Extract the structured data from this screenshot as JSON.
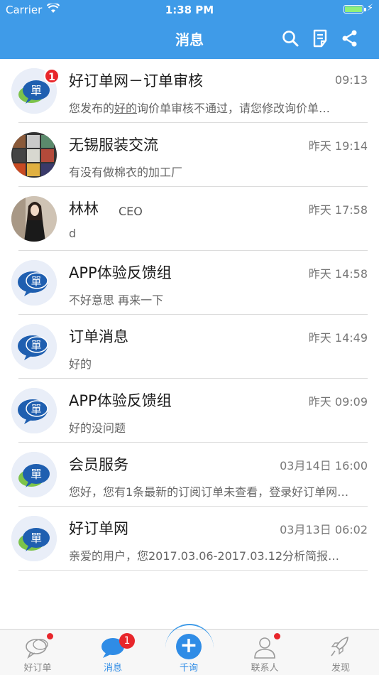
{
  "status_bar": {
    "carrier": "Carrier",
    "time": "1:38 PM"
  },
  "header": {
    "title": "消息"
  },
  "conversations": [
    {
      "title": "好订单网－订单审核",
      "time": "09:13",
      "preview_pre": "您发布的",
      "preview_link": "好的",
      "preview_post": "询价单审核不通过，请您修改询价单…",
      "badge": "1",
      "avatar": "logo-green"
    },
    {
      "title": "无锡服装交流",
      "time": "昨天 19:14",
      "preview": "有没有做棉衣的加工厂",
      "avatar": "group-photo"
    },
    {
      "title": "林林",
      "subtitle": "CEO",
      "time": "昨天 17:58",
      "preview": "d",
      "avatar": "person-photo"
    },
    {
      "title": "APP体验反馈组",
      "time": "昨天 14:58",
      "preview": "不好意思  再来一下",
      "avatar": "logo-blue"
    },
    {
      "title": "订单消息",
      "time": "昨天 14:49",
      "preview": "好的",
      "avatar": "logo-blue"
    },
    {
      "title": "APP体验反馈组",
      "time": "昨天 09:09",
      "preview": "好的没问题",
      "avatar": "logo-blue"
    },
    {
      "title": "会员服务",
      "time": "03月14日 16:00",
      "preview": "您好，您有1条最新的订阅订单未查看，登录好订单网…",
      "avatar": "logo-green"
    },
    {
      "title": "好订单网",
      "time": "03月13日 06:02",
      "preview": "亲爱的用户，您2017.03.06-2017.03.12分析简报…",
      "avatar": "logo-green"
    }
  ],
  "tabbar": {
    "tabs": [
      {
        "label": "好订单",
        "icon": "chat-bubbles-icon"
      },
      {
        "label": "消息",
        "icon": "message-icon",
        "badge": "1"
      },
      {
        "label": "千询",
        "icon": "plus-icon"
      },
      {
        "label": "联系人",
        "icon": "person-icon"
      },
      {
        "label": "发现",
        "icon": "rocket-icon"
      }
    ]
  },
  "colors": {
    "header": "#3f9be8",
    "accent": "#2f8ce6",
    "badge": "#e8262b"
  }
}
